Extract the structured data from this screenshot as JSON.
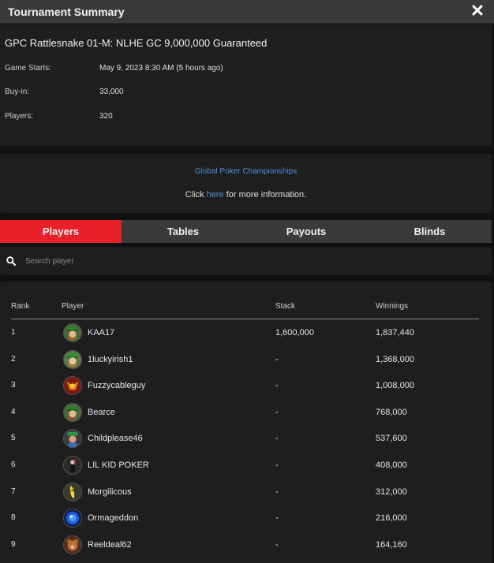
{
  "header": {
    "title": "Tournament Summary",
    "close_icon": "close-icon"
  },
  "summary": {
    "name": "GPC Rattlesnake 01-M: NLHE GC 9,000,000 Guaranteed",
    "fields": [
      {
        "label": "Game Starts:",
        "value": "May 9, 2023 8:30 AM (5 hours ago)"
      },
      {
        "label": "Buy-in:",
        "value": "33,000"
      },
      {
        "label": "Players:",
        "value": "320"
      }
    ]
  },
  "promo": {
    "link": "Global Poker Championships",
    "text_before": "Click ",
    "here": "here",
    "text_after": " for more information."
  },
  "tabs": [
    {
      "label": "Players",
      "active": true
    },
    {
      "label": "Tables",
      "active": false
    },
    {
      "label": "Payouts",
      "active": false
    },
    {
      "label": "Blinds",
      "active": false
    }
  ],
  "search": {
    "placeholder": "Search player",
    "icon": "search-icon"
  },
  "table": {
    "headers": {
      "rank": "Rank",
      "player": "Player",
      "stack": "Stack",
      "winnings": "Winnings"
    },
    "rows": [
      {
        "rank": "1",
        "player": "KAA17",
        "stack": "1,600,000",
        "winnings": "1,837,440",
        "avatar": "leprechaun"
      },
      {
        "rank": "2",
        "player": "1luckyirish1",
        "stack": "-",
        "winnings": "1,368,000",
        "avatar": "leprechaun"
      },
      {
        "rank": "3",
        "player": "Fuzzycableguy",
        "stack": "-",
        "winnings": "1,008,000",
        "avatar": "dragon"
      },
      {
        "rank": "4",
        "player": "Bearce",
        "stack": "-",
        "winnings": "768,000",
        "avatar": "leprechaun"
      },
      {
        "rank": "5",
        "player": "Childplease46",
        "stack": "-",
        "winnings": "537,600",
        "avatar": "character"
      },
      {
        "rank": "6",
        "player": "LIL KID POKER",
        "stack": "-",
        "winnings": "408,000",
        "avatar": "figure"
      },
      {
        "rank": "7",
        "player": "Morgilicous",
        "stack": "-",
        "winnings": "312,000",
        "avatar": "banana"
      },
      {
        "rank": "8",
        "player": "Ormageddon",
        "stack": "-",
        "winnings": "216,000",
        "avatar": "blue-orb"
      },
      {
        "rank": "9",
        "player": "Reeldeal62",
        "stack": "-",
        "winnings": "164,160",
        "avatar": "bear"
      }
    ]
  },
  "colors": {
    "accent": "#e8202a",
    "link": "#4f8fd9",
    "panel": "#1e1e1e",
    "header": "#3a3a3a",
    "background": "#111111"
  }
}
